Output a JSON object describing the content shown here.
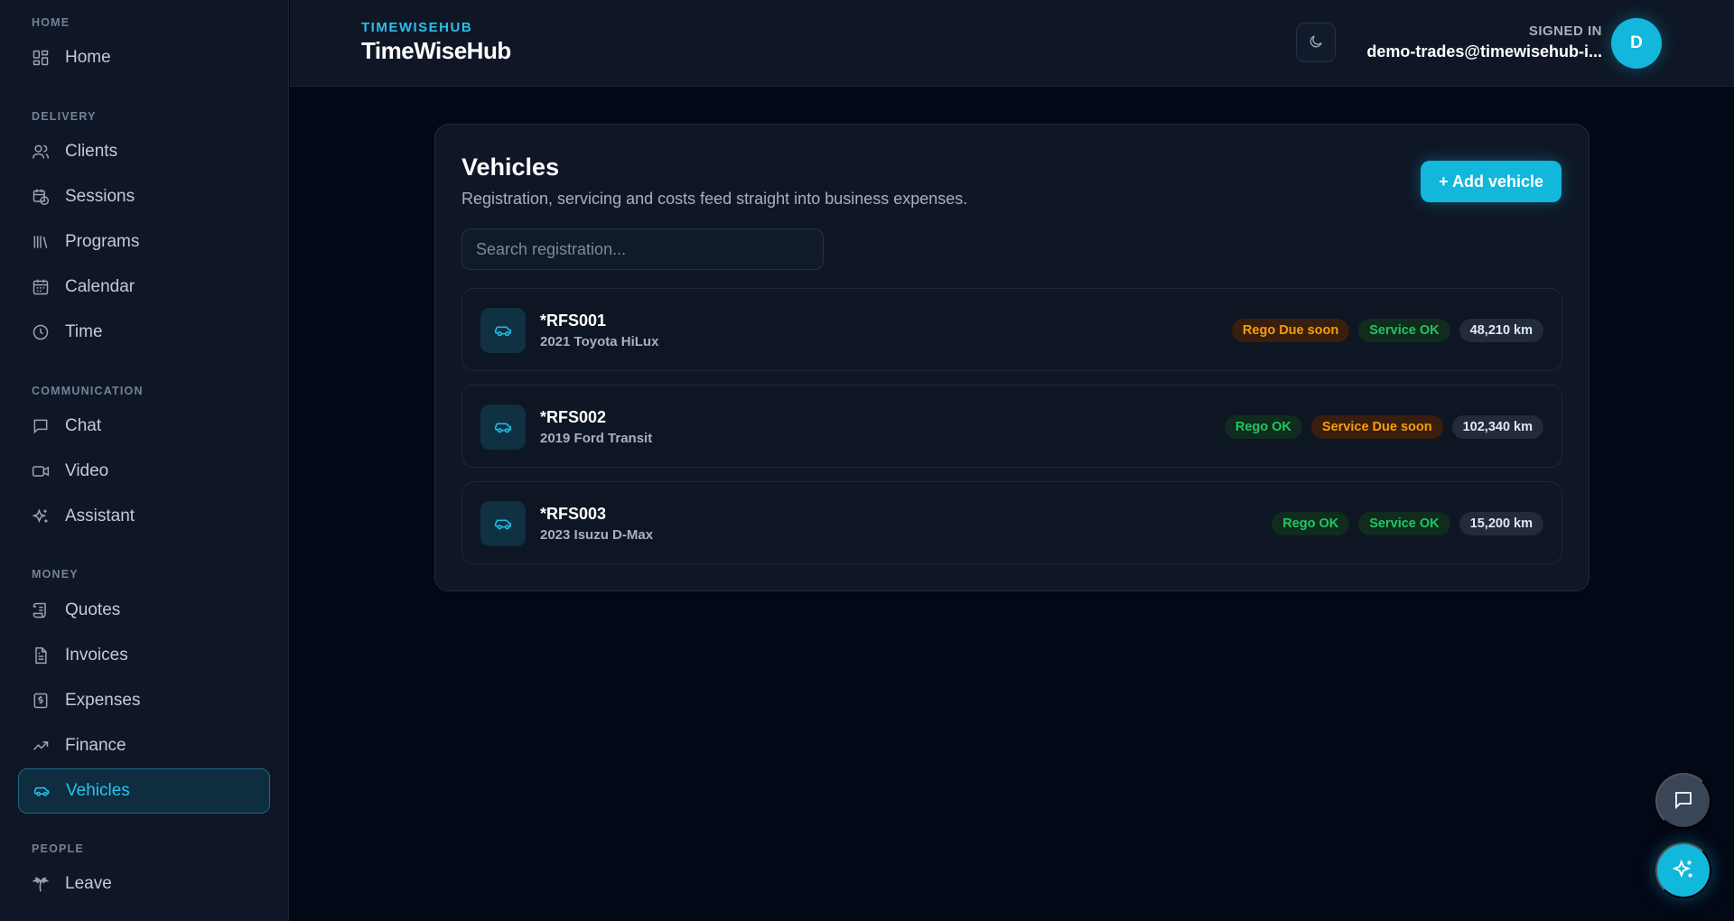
{
  "sidebar": {
    "sections": {
      "home": "HOME",
      "delivery": "DELIVERY",
      "communication": "COMMUNICATION",
      "money": "MONEY",
      "people": "PEOPLE"
    },
    "items": {
      "home": "Home",
      "clients": "Clients",
      "sessions": "Sessions",
      "programs": "Programs",
      "calendar": "Calendar",
      "time": "Time",
      "chat": "Chat",
      "video": "Video",
      "assistant": "Assistant",
      "quotes": "Quotes",
      "invoices": "Invoices",
      "expenses": "Expenses",
      "finance": "Finance",
      "vehicles": "Vehicles",
      "leave": "Leave"
    },
    "active": "Vehicles"
  },
  "header": {
    "brand_small": "TIMEWISEHUB",
    "brand_big": "TimeWiseHub",
    "signed_in_label": "SIGNED IN",
    "user_email": "demo-trades@timewisehub-i...",
    "avatar_initial": "D"
  },
  "main": {
    "title": "Vehicles",
    "subtitle": "Registration, servicing and costs feed straight into business expenses.",
    "add_button": "+ Add vehicle",
    "search_placeholder": "Search registration...",
    "vehicles": [
      {
        "rego": "*RFS001",
        "model": "2021 Toyota HiLux",
        "rego_status": "Rego Due soon",
        "service_status": "Service OK",
        "odometer": "48,210 km"
      },
      {
        "rego": "*RFS002",
        "model": "2019 Ford Transit",
        "rego_status": "Rego OK",
        "service_status": "Service Due soon",
        "odometer": "102,340 km"
      },
      {
        "rego": "*RFS003",
        "model": "2023 Isuzu D-Max",
        "rego_status": "Rego OK",
        "service_status": "Service OK",
        "odometer": "15,200 km"
      }
    ]
  },
  "colors": {
    "accent": "#12b7dc",
    "warning": "#f59e0b",
    "success": "#22c55e"
  }
}
